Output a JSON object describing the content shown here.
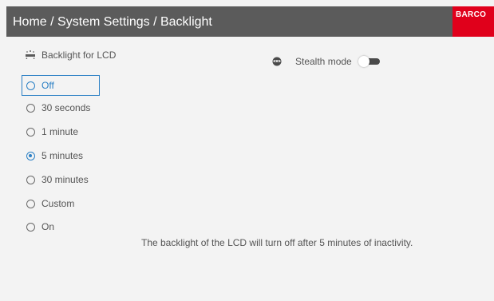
{
  "header": {
    "breadcrumb": "Home / System Settings / Backlight",
    "brand_logo_text": "BARCO",
    "colors": {
      "header_bg": "#5b5b5b",
      "brand_bg": "#e0001b"
    }
  },
  "backlight": {
    "label": "Backlight for LCD",
    "icon": "backlight-icon",
    "options": [
      {
        "label": "Off",
        "selected": false,
        "focused": true
      },
      {
        "label": "30 seconds",
        "selected": false,
        "focused": false
      },
      {
        "label": "1 minute",
        "selected": false,
        "focused": false
      },
      {
        "label": "5 minutes",
        "selected": true,
        "focused": false
      },
      {
        "label": "30 minutes",
        "selected": false,
        "focused": false
      },
      {
        "label": "Custom",
        "selected": false,
        "focused": false
      },
      {
        "label": "On",
        "selected": false,
        "focused": false
      }
    ],
    "selected_value": "5 minutes"
  },
  "stealth": {
    "label": "Stealth mode",
    "icon": "ninja-icon",
    "enabled": false
  },
  "info": {
    "text": "The backlight of the LCD will turn off after 5 minutes of inactivity."
  },
  "colors": {
    "accent": "#2b80c5",
    "background": "#f3f3f3",
    "text": "#555555"
  }
}
